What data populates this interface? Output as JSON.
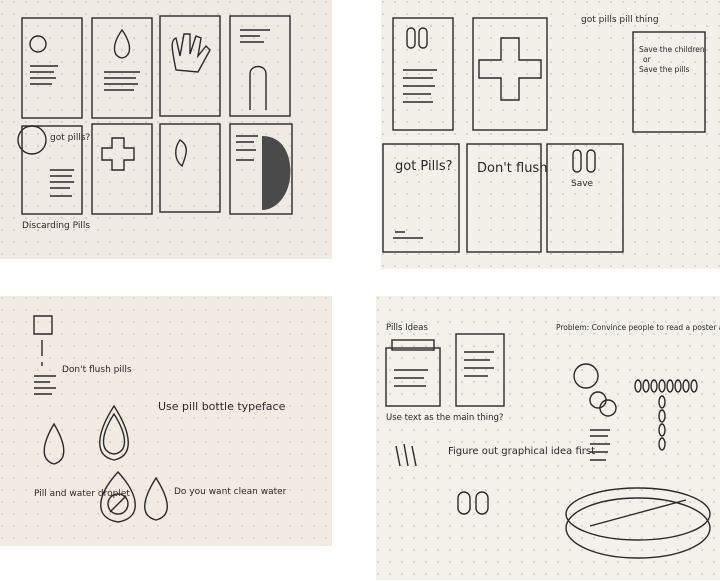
{
  "photos": [
    {
      "labels": {
        "discarding": "Discarding Pills",
        "got_pills_small": "got pills?"
      }
    },
    {
      "labels": {
        "header": "got pills pill thing",
        "save_children": "Save the children",
        "or": "or",
        "save_pills": "Save the pills",
        "got_pills": "got Pills?",
        "dont_flush": "Don't flush",
        "save": "Save"
      }
    },
    {
      "labels": {
        "dont_flush_pills": "Don't flush pills",
        "use_pill_bottle": "Use pill bottle typeface",
        "pill_and_water": "Pill and water droplet",
        "do_you_want": "Do you want clean water"
      }
    },
    {
      "labels": {
        "pills_ideas": "Pills Ideas",
        "problem": "Problem: Convince people to read a poster about disposing pills",
        "use_text": "Use text as the main thing?",
        "figure_out": "Figure out graphical idea first"
      }
    }
  ],
  "colors": {
    "paper": "#f3efe9",
    "paper_dark": "#e9e3da",
    "ink": "#2a2a2a",
    "dot": "#c8c2b8"
  }
}
